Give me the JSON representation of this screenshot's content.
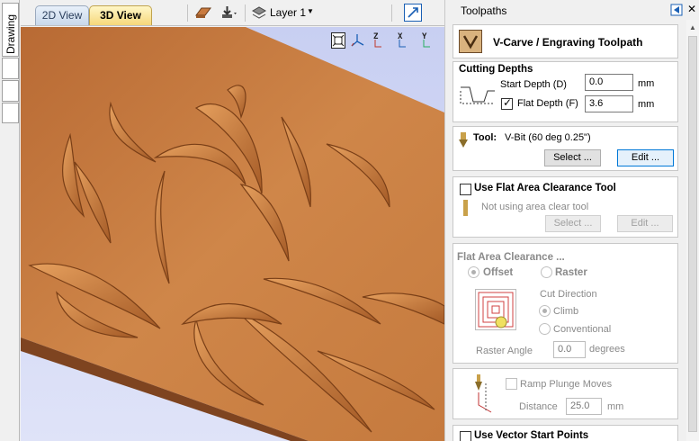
{
  "left_tabs": {
    "drawing": "Drawing"
  },
  "toolbar": {
    "tab_2d": "2D View",
    "tab_3d": "3D View",
    "layer_label": "Layer 1"
  },
  "view_buttons": {
    "z": "Z",
    "x": "X",
    "y": "Y"
  },
  "panel": {
    "title": "Toolpaths",
    "toolpath_title": "V-Carve / Engraving Toolpath",
    "cutting_depths": {
      "header": "Cutting Depths",
      "start_depth_label": "Start Depth (D)",
      "start_depth_value": "0.0",
      "start_depth_unit": "mm",
      "flat_depth_label": "Flat Depth (F)",
      "flat_depth_value": "3.6",
      "flat_depth_unit": "mm",
      "flat_depth_checked": true
    },
    "tool": {
      "label": "Tool:",
      "name": "V-Bit (60 deg 0.25\")",
      "select_button": "Select ...",
      "edit_button": "Edit ..."
    },
    "flat_area_tool": {
      "header": "Use Flat Area Clearance Tool",
      "status": "Not using area clear tool",
      "select_button": "Select ...",
      "edit_button": "Edit ..."
    },
    "flat_area_clearance": {
      "header": "Flat Area Clearance ...",
      "offset_label": "Offset",
      "raster_label": "Raster",
      "cut_direction_label": "Cut Direction",
      "climb_label": "Climb",
      "conventional_label": "Conventional",
      "raster_angle_label": "Raster Angle",
      "raster_angle_value": "0.0",
      "raster_angle_unit": "degrees"
    },
    "ramp": {
      "label": "Ramp Plunge Moves",
      "distance_label": "Distance",
      "distance_value": "25.0",
      "distance_unit": "mm"
    },
    "vector_start": {
      "header": "Use Vector Start Points"
    }
  },
  "colors": {
    "accent": "#0078d7",
    "wood": "#c97a3f",
    "viewport_bg": "#c8cff2"
  }
}
